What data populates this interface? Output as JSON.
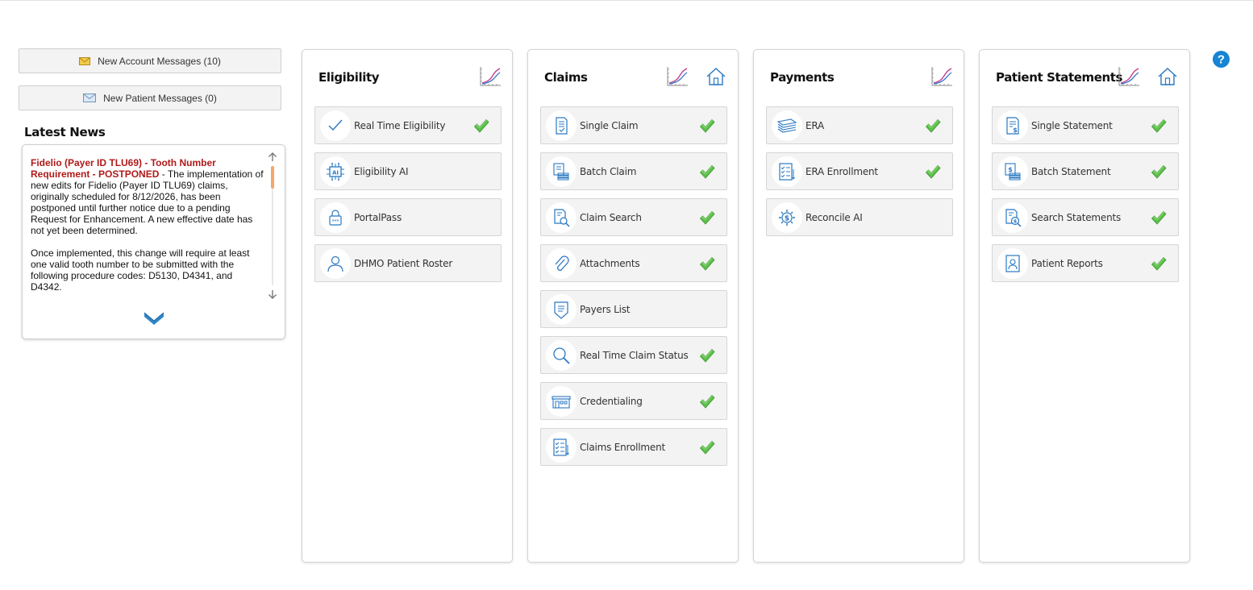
{
  "messages": {
    "account_label": "New Account Messages (10)",
    "patient_label": "New Patient Messages (0)"
  },
  "news": {
    "heading": "Latest News",
    "headline": "Fidelio (Payer ID TLU69) - Tooth Number Requirement - POSTPONED",
    "headline_part1": "Fidelio (Payer ID TLU69) - Tooth Number Requirement - ",
    "headline_part2": "POSTPONED",
    "body1": " - The implementation of new edits for Fidelio (Payer ID TLU69) claims, originally scheduled for 8/12/2026, has been postponed until further notice due to a pending Request for Enhancement. A new effective date has not yet been determined.",
    "body2": "Once implemented, this change will require at least one valid tooth number to be submitted with the following procedure codes: D5130, D4341, and D4342."
  },
  "panels": {
    "eligibility": {
      "title": "Eligibility",
      "items": [
        {
          "label": "Real Time Eligibility",
          "icon": "checkmark-icon",
          "checked": true
        },
        {
          "label": "Eligibility AI",
          "icon": "ai-chip-icon",
          "checked": false
        },
        {
          "label": "PortalPass",
          "icon": "lock-icon",
          "checked": false
        },
        {
          "label": "DHMO Patient Roster",
          "icon": "person-icon",
          "checked": false
        }
      ]
    },
    "claims": {
      "title": "Claims",
      "items": [
        {
          "label": "Single Claim",
          "icon": "document-check-icon",
          "checked": true
        },
        {
          "label": "Batch Claim",
          "icon": "stacked-documents-icon",
          "checked": true
        },
        {
          "label": "Claim Search",
          "icon": "document-search-icon",
          "checked": true
        },
        {
          "label": "Attachments",
          "icon": "paperclip-icon",
          "checked": true
        },
        {
          "label": "Payers List",
          "icon": "shield-list-icon",
          "checked": false
        },
        {
          "label": "Real Time Claim Status",
          "icon": "magnifier-icon",
          "checked": true
        },
        {
          "label": "Credentialing",
          "icon": "building-icon",
          "checked": true
        },
        {
          "label": "Claims Enrollment",
          "icon": "checklist-icon",
          "checked": true
        }
      ]
    },
    "payments": {
      "title": "Payments",
      "items": [
        {
          "label": "ERA",
          "icon": "money-stack-icon",
          "checked": true
        },
        {
          "label": "ERA Enrollment",
          "icon": "checklist-icon",
          "checked": true
        },
        {
          "label": "Reconcile AI",
          "icon": "dollar-gear-icon",
          "checked": false
        }
      ]
    },
    "statements": {
      "title": "Patient Statements",
      "items": [
        {
          "label": "Single Statement",
          "icon": "dollar-document-icon",
          "checked": true
        },
        {
          "label": "Batch Statement",
          "icon": "stacked-dollar-documents-icon",
          "checked": true
        },
        {
          "label": "Search Statements",
          "icon": "dollar-search-icon",
          "checked": true
        },
        {
          "label": "Patient Reports",
          "icon": "person-report-icon",
          "checked": true
        }
      ]
    }
  },
  "colors": {
    "icon_blue": "#2a78c2",
    "check_green": "#5cc04a",
    "news_red": "#b01919",
    "help_blue": "#1784d4"
  }
}
